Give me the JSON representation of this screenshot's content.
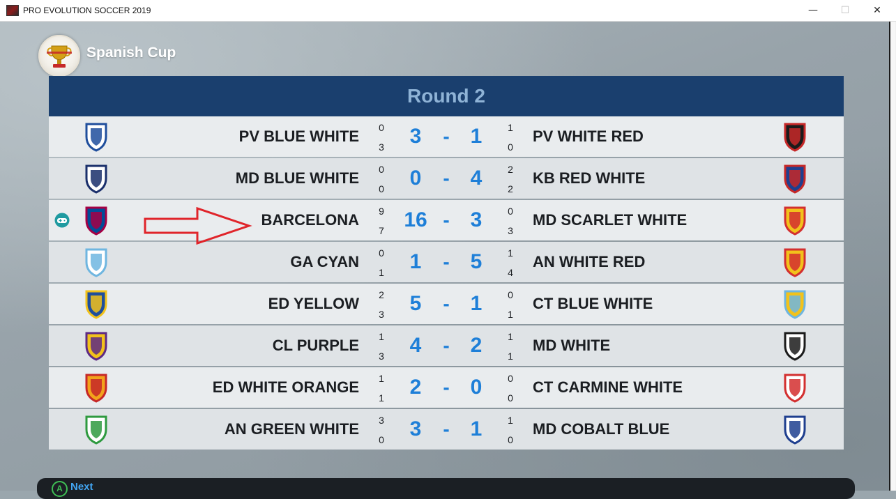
{
  "window": {
    "title": "PRO EVOLUTION SOCCER 2019",
    "minimize_glyph": "—",
    "maximize_glyph": "☐",
    "close_glyph": "✕"
  },
  "competition": {
    "name": "Spanish Cup",
    "logo_icon": "spanish-cup-trophy-icon"
  },
  "round": {
    "title": "Round 2"
  },
  "matches": [
    {
      "home": "PV BLUE WHITE",
      "home_leg1": "0",
      "home_leg2": "3",
      "home_score": "3",
      "away_score": "1",
      "away_leg1": "1",
      "away_leg2": "0",
      "away": "PV WHITE RED",
      "home_crest": "pv-blue-white-crest-icon",
      "away_crest": "pv-white-red-crest-icon"
    },
    {
      "home": "MD BLUE WHITE",
      "home_leg1": "0",
      "home_leg2": "0",
      "home_score": "0",
      "away_score": "4",
      "away_leg1": "2",
      "away_leg2": "2",
      "away": "KB RED WHITE",
      "home_crest": "md-blue-white-crest-icon",
      "away_crest": "kb-red-white-crest-icon"
    },
    {
      "home": "BARCELONA",
      "home_leg1": "9",
      "home_leg2": "7",
      "home_score": "16",
      "away_score": "3",
      "away_leg1": "0",
      "away_leg2": "3",
      "away": "MD SCARLET WHITE",
      "home_crest": "barcelona-crest-icon",
      "away_crest": "md-scarlet-white-crest-icon",
      "user_team": true
    },
    {
      "home": "GA CYAN",
      "home_leg1": "0",
      "home_leg2": "1",
      "home_score": "1",
      "away_score": "5",
      "away_leg1": "1",
      "away_leg2": "4",
      "away": "AN WHITE RED",
      "home_crest": "ga-cyan-crest-icon",
      "away_crest": "an-white-red-crest-icon"
    },
    {
      "home": "ED YELLOW",
      "home_leg1": "2",
      "home_leg2": "3",
      "home_score": "5",
      "away_score": "1",
      "away_leg1": "0",
      "away_leg2": "1",
      "away": "CT BLUE WHITE",
      "home_crest": "ed-yellow-crest-icon",
      "away_crest": "ct-blue-white-crest-icon"
    },
    {
      "home": "CL PURPLE",
      "home_leg1": "1",
      "home_leg2": "3",
      "home_score": "4",
      "away_score": "2",
      "away_leg1": "1",
      "away_leg2": "1",
      "away": "MD WHITE",
      "home_crest": "cl-purple-crest-icon",
      "away_crest": "md-white-crest-icon"
    },
    {
      "home": "ED WHITE ORANGE",
      "home_leg1": "1",
      "home_leg2": "1",
      "home_score": "2",
      "away_score": "0",
      "away_leg1": "0",
      "away_leg2": "0",
      "away": "CT CARMINE WHITE",
      "home_crest": "ed-white-orange-crest-icon",
      "away_crest": "ct-carmine-white-crest-icon"
    },
    {
      "home": "AN GREEN WHITE",
      "home_leg1": "3",
      "home_leg2": "0",
      "home_score": "3",
      "away_score": "1",
      "away_leg1": "1",
      "away_leg2": "0",
      "away": "MD COBALT BLUE",
      "home_crest": "an-green-white-crest-icon",
      "away_crest": "md-cobalt-blue-crest-icon"
    }
  ],
  "score_separator": "-",
  "footer": {
    "button_glyph": "A",
    "next_label": "Next"
  },
  "colors": {
    "header_bg": "#1a3f6e",
    "round_title": "#8fb3d6",
    "score_blue": "#1e7fd8",
    "arrow_red": "#e0242a",
    "a_button_green": "#3fbf55",
    "next_blue": "#42a4f0"
  }
}
